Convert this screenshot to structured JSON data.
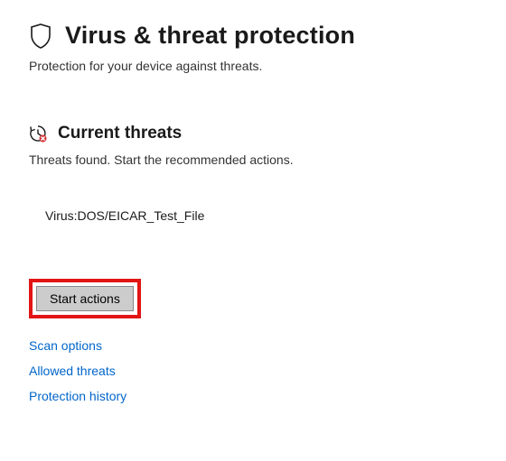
{
  "page": {
    "title": "Virus & threat protection",
    "subtitle": "Protection for your device against threats."
  },
  "currentThreats": {
    "title": "Current threats",
    "subtitle": "Threats found. Start the recommended actions.",
    "items": [
      {
        "name": "Virus:DOS/EICAR_Test_File"
      }
    ],
    "startActionsLabel": "Start actions"
  },
  "links": {
    "scanOptions": "Scan options",
    "allowedThreats": "Allowed threats",
    "protectionHistory": "Protection history"
  },
  "highlight": {
    "color": "#e21515"
  }
}
